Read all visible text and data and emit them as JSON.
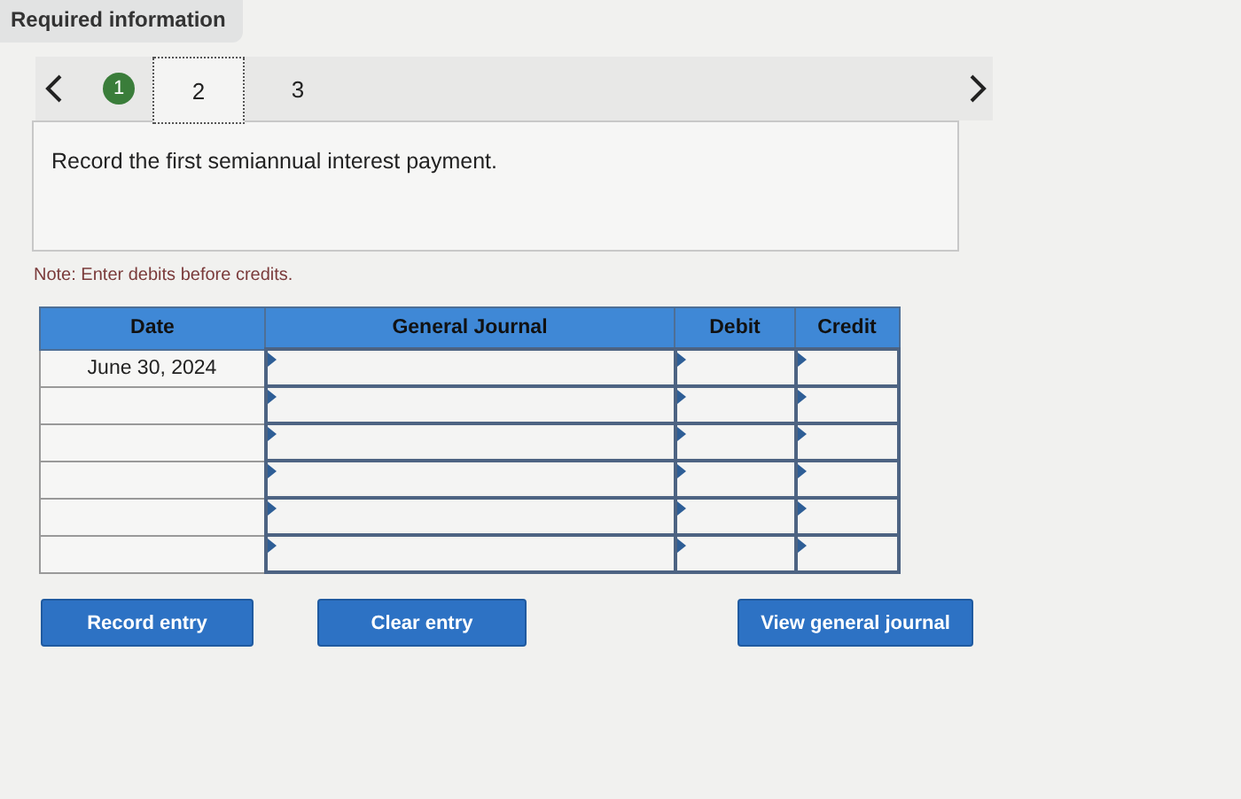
{
  "header": {
    "title": "Required information"
  },
  "steps": [
    {
      "label": "1",
      "selected": false,
      "done": true
    },
    {
      "label": "2",
      "selected": true,
      "done": false
    },
    {
      "label": "3",
      "selected": false,
      "done": false
    }
  ],
  "instruction": "Record the first semiannual interest payment.",
  "note": "Note: Enter debits before credits.",
  "table": {
    "columns": [
      "Date",
      "General Journal",
      "Debit",
      "Credit"
    ],
    "rows": [
      {
        "date": "June 30, 2024"
      },
      {
        "date": ""
      },
      {
        "date": ""
      },
      {
        "date": ""
      },
      {
        "date": ""
      },
      {
        "date": ""
      }
    ]
  },
  "buttons": [
    "Record entry",
    "Clear entry",
    "View general journal"
  ]
}
